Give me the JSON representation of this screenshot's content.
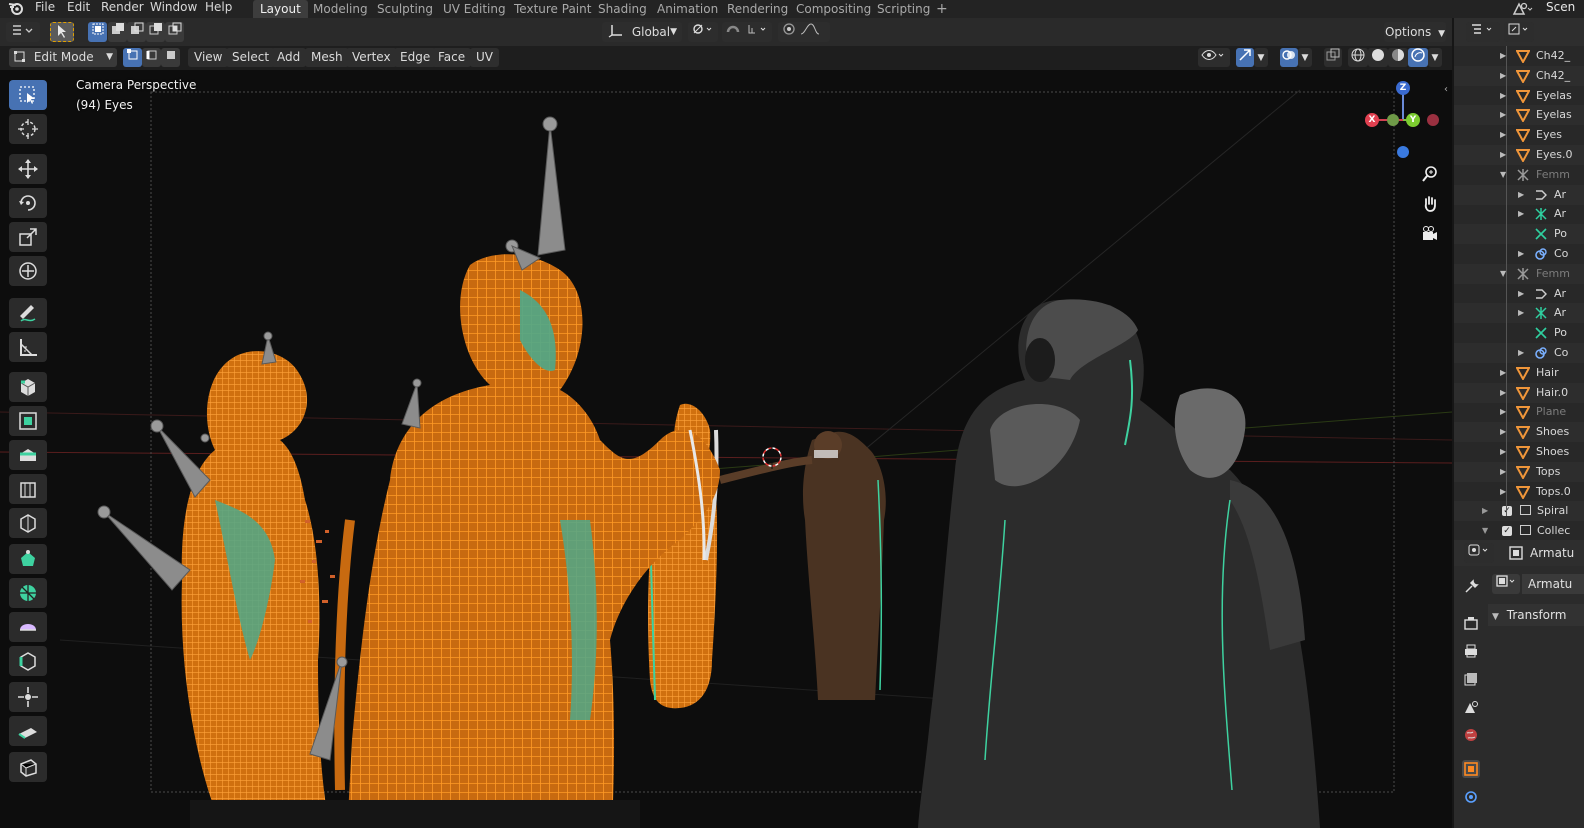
{
  "menu": {
    "file": "File",
    "edit": "Edit",
    "render": "Render",
    "window": "Window",
    "help": "Help"
  },
  "workspaces": [
    "Layout",
    "Modeling",
    "Sculpting",
    "UV Editing",
    "Texture Paint",
    "Shading",
    "Animation",
    "Rendering",
    "Compositing",
    "Scripting"
  ],
  "workspace_add": "+",
  "scene_label": "Scen",
  "header": {
    "orientation": "Global",
    "options": "Options",
    "mode": "Edit Mode",
    "menus": [
      "View",
      "Select",
      "Add",
      "Mesh",
      "Vertex",
      "Edge",
      "Face",
      "UV"
    ]
  },
  "viewport": {
    "label_perspective": "Camera Perspective",
    "label_object": "(94) Eyes",
    "gizmo": {
      "x": "X",
      "y": "Y",
      "z": "Z"
    }
  },
  "outliner": {
    "items": [
      {
        "label": "Ch42_",
        "kind": "mesh"
      },
      {
        "label": "Ch42_",
        "kind": "mesh"
      },
      {
        "label": "Eyelas",
        "kind": "mesh"
      },
      {
        "label": "Eyelas",
        "kind": "mesh"
      },
      {
        "label": "Eyes",
        "kind": "mesh"
      },
      {
        "label": "Eyes.0",
        "kind": "mesh"
      },
      {
        "label": "Femm",
        "kind": "armature"
      },
      {
        "label": "Ar",
        "kind": "action"
      },
      {
        "label": "Ar",
        "kind": "armature-data"
      },
      {
        "label": "Po",
        "kind": "pose"
      },
      {
        "label": "Co",
        "kind": "constraint"
      },
      {
        "label": "Femm",
        "kind": "armature"
      },
      {
        "label": "Ar",
        "kind": "action"
      },
      {
        "label": "Ar",
        "kind": "armature-data"
      },
      {
        "label": "Po",
        "kind": "pose"
      },
      {
        "label": "Co",
        "kind": "constraint"
      },
      {
        "label": "Hair",
        "kind": "mesh"
      },
      {
        "label": "Hair.0",
        "kind": "mesh"
      },
      {
        "label": "Plane",
        "kind": "mesh"
      },
      {
        "label": "Shoes",
        "kind": "mesh"
      },
      {
        "label": "Shoes",
        "kind": "mesh"
      },
      {
        "label": "Tops",
        "kind": "mesh"
      },
      {
        "label": "Tops.0",
        "kind": "mesh"
      },
      {
        "label": "Spiral",
        "kind": "collection"
      },
      {
        "label": "Collec",
        "kind": "collection"
      }
    ]
  },
  "properties": {
    "object_name": "Armatu",
    "object_name_sub": "Armatu",
    "panel_transform": "Transform"
  }
}
